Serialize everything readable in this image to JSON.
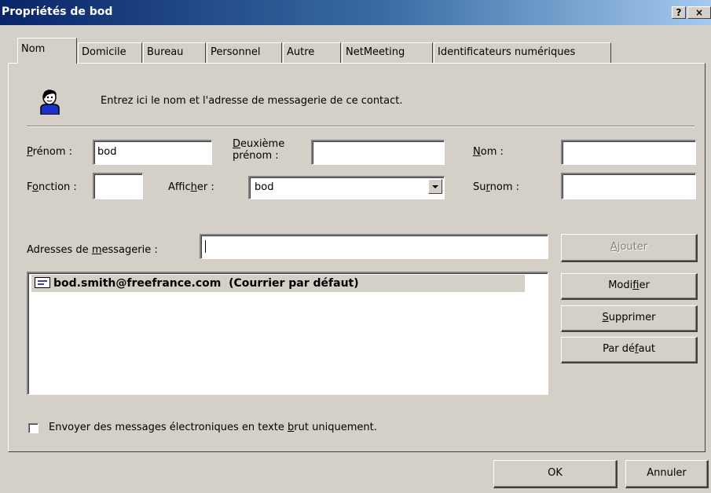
{
  "window": {
    "title": "Propriétés de bod",
    "help_button": "?",
    "close_button": "×"
  },
  "tabs": [
    {
      "label": "Nom",
      "active": true
    },
    {
      "label": "Domicile"
    },
    {
      "label": "Bureau"
    },
    {
      "label": "Personnel"
    },
    {
      "label": "Autre"
    },
    {
      "label": "NetMeeting"
    },
    {
      "label": "Identificateurs numériques"
    }
  ],
  "intro": {
    "icon": "person-icon",
    "text": "Entrez ici le nom et l'adresse de messagerie de ce contact."
  },
  "fields": {
    "prenom": {
      "label_u": "P",
      "label_rest": "rénom :",
      "value": "bod"
    },
    "deuxieme": {
      "label_u": "D",
      "label_rest": "euxième",
      "label_line2": "prénom :",
      "value": ""
    },
    "nom": {
      "label_u": "N",
      "label_rest": "om :",
      "value": ""
    },
    "fonction": {
      "label_pre": "F",
      "label_u": "o",
      "label_rest": "nction :",
      "value": ""
    },
    "afficher": {
      "label_pre": "Affic",
      "label_u": "h",
      "label_rest": "er :",
      "value": "bod"
    },
    "surnom": {
      "label_pre": "Su",
      "label_u": "r",
      "label_rest": "nom :",
      "value": ""
    },
    "adresses": {
      "label_pre": "Adresses de ",
      "label_u": "m",
      "label_rest": "essagerie :",
      "value": ""
    }
  },
  "email_list": [
    {
      "address": "bod.smith@freefrance.com",
      "note": "(Courrier par défaut)"
    }
  ],
  "buttons": {
    "ajouter": {
      "u": "A",
      "rest": "jouter"
    },
    "modifier": {
      "pre": "Modi",
      "u": "f",
      "rest": "ier"
    },
    "supprimer": {
      "u": "S",
      "rest": "upprimer"
    },
    "par_defaut": {
      "pre": "Par dé",
      "u": "f",
      "rest": "aut"
    }
  },
  "plain_text": {
    "pre": "Envoyer des messages électroniques en texte ",
    "u": "b",
    "rest": "rut uniquement.",
    "checked": false
  },
  "footer": {
    "ok": "OK",
    "cancel": "Annuler"
  }
}
